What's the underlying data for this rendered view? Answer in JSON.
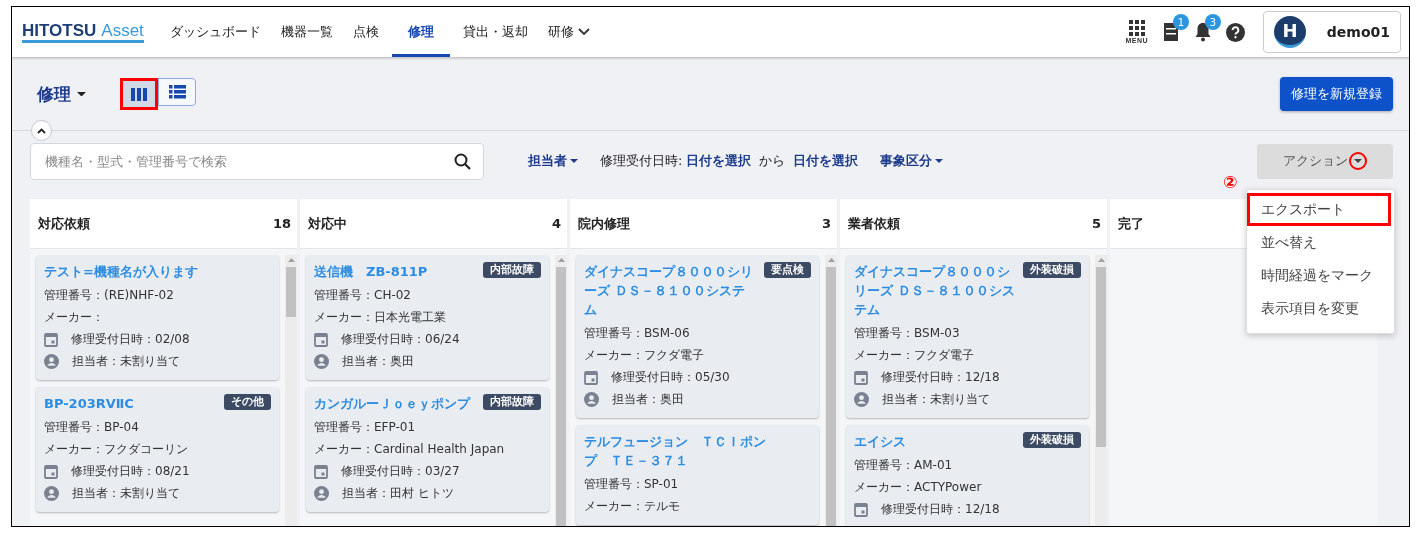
{
  "header": {
    "logo": {
      "brand": "HITOTSU",
      "suffix": "Asset"
    },
    "nav": [
      {
        "label": "ダッシュボード",
        "selected": false,
        "kind": "link"
      },
      {
        "label": "機器一覧",
        "selected": false,
        "kind": "link"
      },
      {
        "label": "点検",
        "selected": false,
        "kind": "link"
      },
      {
        "label": "修理",
        "selected": true,
        "kind": "link"
      },
      {
        "label": "貸出・返却",
        "selected": false,
        "kind": "link"
      },
      {
        "label": "研修",
        "selected": false,
        "kind": "dropdown"
      }
    ],
    "menu_label": "MENU",
    "pmda_badge": "1",
    "notification_badge": "3",
    "user": {
      "initial": "H",
      "name": "demo01"
    }
  },
  "toolbar": {
    "title": "修理",
    "views": [
      {
        "kind": "board",
        "selected": true,
        "highlighted": true
      },
      {
        "kind": "list",
        "selected": false,
        "highlighted": false
      }
    ],
    "new_button": "修理を新規登録"
  },
  "filters": {
    "search": {
      "placeholder": "機種名・型式・管理番号で検索"
    },
    "assignee": "担当者",
    "date_label": "修理受付日時:",
    "date_from": "日付を選択",
    "date_between": "から",
    "date_to": "日付を選択",
    "category": "事象区分",
    "action": {
      "label": "アクション",
      "marker": "②",
      "open": true,
      "items": [
        {
          "label": "エクスポート",
          "highlighted": true
        },
        {
          "label": "並べ替え",
          "highlighted": false
        },
        {
          "label": "時間経過をマーク",
          "highlighted": false
        },
        {
          "label": "表示項目を変更",
          "highlighted": false
        }
      ]
    }
  },
  "columns": [
    {
      "title": "対応依頼",
      "count": "18",
      "cards": [
        {
          "title": "テスト=機種名が入ります",
          "id": "管理番号：(RE)NHF-02",
          "maker": "メーカー：",
          "date": "修理受付日時：02/08",
          "assignee": "担当者：未割り当て"
        },
        {
          "title": "BP-203RVⅡC",
          "tag": "その他",
          "id": "管理番号：BP-04",
          "maker": "メーカー：フクダコーリン",
          "date": "修理受付日時：08/21",
          "assignee": "担当者：未割り当て"
        }
      ]
    },
    {
      "title": "対応中",
      "count": "4",
      "cards": [
        {
          "title": "送信機　ZB-811P",
          "tag": "内部故障",
          "id": "管理番号：CH-02",
          "maker": "メーカー：日本光電工業",
          "date": "修理受付日時：06/24",
          "assignee": "担当者：奥田"
        },
        {
          "title": "カンガルーＪｏｅｙポンプ",
          "tag": "内部故障",
          "id": "管理番号：EFP-01",
          "maker": "メーカー：Cardinal Health Japan",
          "date": "修理受付日時：03/27",
          "assignee": "担当者：田村 ヒトツ"
        }
      ]
    },
    {
      "title": "院内修理",
      "count": "3",
      "cards": [
        {
          "title": "ダイナスコープ８０００シリーズ ＤＳ－８１００システム",
          "tag": "要点検",
          "id": "管理番号：BSM-06",
          "maker": "メーカー：フクダ電子",
          "date": "修理受付日時：05/30",
          "assignee": "担当者：奥田"
        },
        {
          "title": "テルフュージョン　ＴＣＩポンプ　ＴＥ－３７１",
          "id": "管理番号：SP-01",
          "maker": "メーカー：テルモ"
        }
      ]
    },
    {
      "title": "業者依頼",
      "count": "5",
      "cards": [
        {
          "title": "ダイナスコープ８０００シリーズ ＤＳ－８１００システム",
          "tag": "外装破損",
          "id": "管理番号：BSM-03",
          "maker": "メーカー：フクダ電子",
          "date": "修理受付日時：12/18",
          "assignee": "担当者：未割り当て"
        },
        {
          "title": "エイシス",
          "tag": "外装破損",
          "id": "管理番号：AM-01",
          "maker": "メーカー：ACTYPower",
          "date": "修理受付日時：12/18"
        }
      ]
    },
    {
      "title": "完了"
    }
  ]
}
